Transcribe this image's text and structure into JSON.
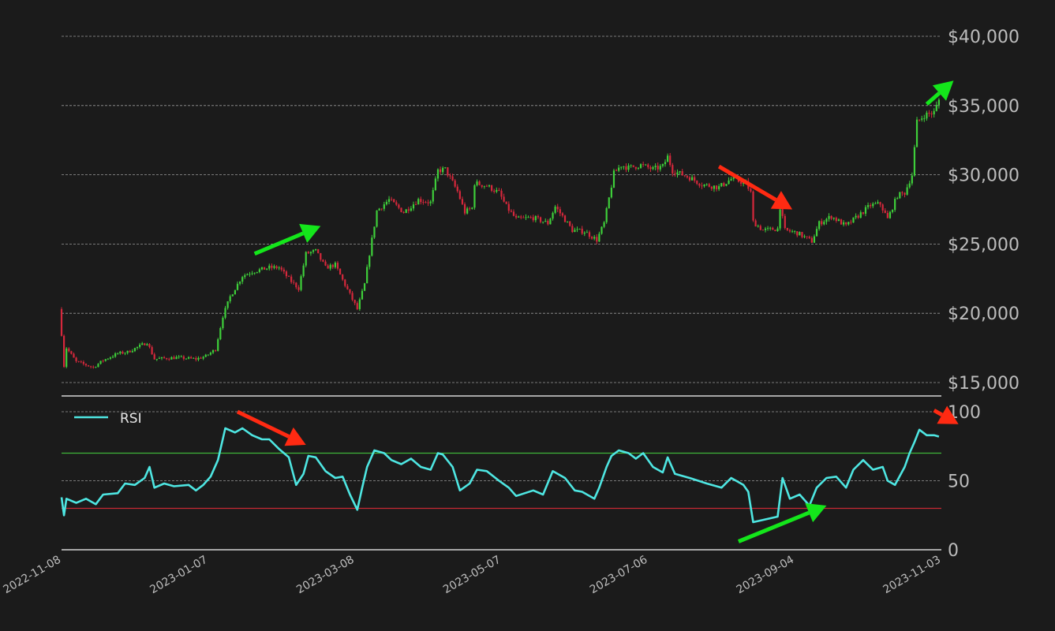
{
  "colors": {
    "background": "#1b1b1b",
    "up_candle": "#3ecf3a",
    "down_candle": "#d6283c",
    "rsi_line": "#4ee6e2",
    "overbought_line": "#3fb63a",
    "oversold_line": "#c82a33",
    "grid": "#9a9a9a",
    "axis_text": "#bdbdbd",
    "arrow_green": "#14e61b",
    "arrow_red": "#ff2a12"
  },
  "chart_data": [
    {
      "type": "candlestick",
      "title": "",
      "xlabel": "",
      "ylabel": "",
      "ylim": [
        14000,
        40500
      ],
      "y_ticks": [
        15000,
        20000,
        25000,
        30000,
        35000,
        40000
      ],
      "y_tick_labels": [
        "$15,000",
        "$20,000",
        "$25,000",
        "$30,000",
        "$35,000",
        "$40,000"
      ],
      "x_range": [
        "2022-11-08",
        "2023-11-03"
      ],
      "x_tick_labels": [
        "2022-11-08",
        "2023-01-07",
        "2023-03-08",
        "2023-05-07",
        "2023-07-06",
        "2023-09-04",
        "2023-11-03"
      ],
      "grid": true,
      "close_anchors": [
        [
          "2022-11-08",
          18500
        ],
        [
          "2022-11-09",
          16200
        ],
        [
          "2022-11-10",
          17500
        ],
        [
          "2022-11-14",
          16500
        ],
        [
          "2022-11-21",
          16100
        ],
        [
          "2022-11-25",
          16600
        ],
        [
          "2022-12-01",
          17100
        ],
        [
          "2022-12-05",
          17200
        ],
        [
          "2022-12-13",
          17900
        ],
        [
          "2022-12-16",
          16700
        ],
        [
          "2022-12-25",
          16800
        ],
        [
          "2023-01-02",
          16700
        ],
        [
          "2023-01-06",
          16900
        ],
        [
          "2023-01-10",
          17400
        ],
        [
          "2023-01-13",
          19800
        ],
        [
          "2023-01-16",
          21200
        ],
        [
          "2023-01-21",
          22700
        ],
        [
          "2023-01-25",
          23000
        ],
        [
          "2023-02-01",
          23300
        ],
        [
          "2023-02-05",
          23300
        ],
        [
          "2023-02-10",
          22300
        ],
        [
          "2023-02-13",
          21800
        ],
        [
          "2023-02-16",
          24300
        ],
        [
          "2023-02-20",
          24500
        ],
        [
          "2023-02-24",
          23300
        ],
        [
          "2023-02-28",
          23500
        ],
        [
          "2023-03-03",
          22400
        ],
        [
          "2023-03-09",
          20300
        ],
        [
          "2023-03-12",
          22100
        ],
        [
          "2023-03-14",
          24300
        ],
        [
          "2023-03-17",
          27400
        ],
        [
          "2023-03-22",
          28200
        ],
        [
          "2023-03-28",
          27300
        ],
        [
          "2023-04-03",
          28200
        ],
        [
          "2023-04-08",
          28000
        ],
        [
          "2023-04-11",
          30300
        ],
        [
          "2023-04-14",
          30400
        ],
        [
          "2023-04-19",
          28800
        ],
        [
          "2023-04-22",
          27300
        ],
        [
          "2023-04-25",
          27600
        ],
        [
          "2023-04-26",
          29400
        ],
        [
          "2023-05-01",
          29200
        ],
        [
          "2023-05-06",
          28700
        ],
        [
          "2023-05-09",
          27700
        ],
        [
          "2023-05-13",
          26800
        ],
        [
          "2023-05-20",
          26900
        ],
        [
          "2023-05-26",
          26500
        ],
        [
          "2023-05-29",
          27700
        ],
        [
          "2023-06-01",
          27000
        ],
        [
          "2023-06-05",
          26000
        ],
        [
          "2023-06-10",
          25900
        ],
        [
          "2023-06-15",
          25300
        ],
        [
          "2023-06-18",
          26500
        ],
        [
          "2023-06-20",
          28300
        ],
        [
          "2023-06-22",
          30100
        ],
        [
          "2023-06-25",
          30700
        ],
        [
          "2023-06-28",
          30500
        ],
        [
          "2023-07-03",
          30700
        ],
        [
          "2023-07-08",
          30400
        ],
        [
          "2023-07-12",
          30600
        ],
        [
          "2023-07-14",
          31300
        ],
        [
          "2023-07-16",
          30300
        ],
        [
          "2023-07-23",
          29800
        ],
        [
          "2023-07-28",
          29300
        ],
        [
          "2023-08-04",
          29100
        ],
        [
          "2023-08-09",
          29700
        ],
        [
          "2023-08-15",
          29400
        ],
        [
          "2023-08-17",
          28700
        ],
        [
          "2023-08-18",
          26600
        ],
        [
          "2023-08-22",
          26000
        ],
        [
          "2023-08-28",
          26100
        ],
        [
          "2023-08-29",
          27700
        ],
        [
          "2023-08-31",
          26000
        ],
        [
          "2023-09-05",
          25800
        ],
        [
          "2023-09-11",
          25200
        ],
        [
          "2023-09-14",
          26500
        ],
        [
          "2023-09-19",
          27000
        ],
        [
          "2023-09-25",
          26300
        ],
        [
          "2023-10-01",
          27200
        ],
        [
          "2023-10-05",
          27800
        ],
        [
          "2023-10-09",
          27900
        ],
        [
          "2023-10-12",
          26800
        ],
        [
          "2023-10-16",
          28500
        ],
        [
          "2023-10-19",
          28700
        ],
        [
          "2023-10-22",
          30000
        ],
        [
          "2023-10-24",
          33800
        ],
        [
          "2023-10-27",
          34300
        ],
        [
          "2023-10-31",
          34500
        ],
        [
          "2023-11-02",
          35400
        ]
      ]
    },
    {
      "type": "line",
      "title": "",
      "xlabel": "",
      "ylabel": "",
      "ylim": [
        0,
        100
      ],
      "y_ticks": [
        0,
        50,
        100
      ],
      "y_tick_labels": [
        "0",
        "50",
        "100"
      ],
      "legend": {
        "position": "top-left"
      },
      "overbought_level": 70,
      "oversold_level": 30,
      "series": [
        {
          "name": "RSI",
          "points": [
            [
              "2022-11-08",
              38
            ],
            [
              "2022-11-09",
              25
            ],
            [
              "2022-11-10",
              37
            ],
            [
              "2022-11-14",
              34
            ],
            [
              "2022-11-18",
              37
            ],
            [
              "2022-11-22",
              33
            ],
            [
              "2022-11-25",
              40
            ],
            [
              "2022-12-01",
              41
            ],
            [
              "2022-12-04",
              48
            ],
            [
              "2022-12-08",
              47
            ],
            [
              "2022-12-12",
              52
            ],
            [
              "2022-12-14",
              60
            ],
            [
              "2022-12-16",
              45
            ],
            [
              "2022-12-20",
              48
            ],
            [
              "2022-12-24",
              46
            ],
            [
              "2022-12-30",
              47
            ],
            [
              "2023-01-02",
              43
            ],
            [
              "2023-01-05",
              47
            ],
            [
              "2023-01-08",
              53
            ],
            [
              "2023-01-11",
              65
            ],
            [
              "2023-01-14",
              88
            ],
            [
              "2023-01-18",
              85
            ],
            [
              "2023-01-21",
              88
            ],
            [
              "2023-01-25",
              83
            ],
            [
              "2023-01-29",
              80
            ],
            [
              "2023-02-01",
              80
            ],
            [
              "2023-02-05",
              73
            ],
            [
              "2023-02-09",
              67
            ],
            [
              "2023-02-12",
              47
            ],
            [
              "2023-02-15",
              55
            ],
            [
              "2023-02-17",
              68
            ],
            [
              "2023-02-20",
              67
            ],
            [
              "2023-02-24",
              57
            ],
            [
              "2023-02-28",
              52
            ],
            [
              "2023-03-03",
              53
            ],
            [
              "2023-03-06",
              40
            ],
            [
              "2023-03-09",
              29
            ],
            [
              "2023-03-11",
              45
            ],
            [
              "2023-03-13",
              60
            ],
            [
              "2023-03-16",
              72
            ],
            [
              "2023-03-20",
              70
            ],
            [
              "2023-03-23",
              65
            ],
            [
              "2023-03-27",
              62
            ],
            [
              "2023-03-31",
              66
            ],
            [
              "2023-04-04",
              60
            ],
            [
              "2023-04-08",
              58
            ],
            [
              "2023-04-11",
              70
            ],
            [
              "2023-04-13",
              69
            ],
            [
              "2023-04-17",
              60
            ],
            [
              "2023-04-20",
              43
            ],
            [
              "2023-04-24",
              48
            ],
            [
              "2023-04-27",
              58
            ],
            [
              "2023-05-01",
              57
            ],
            [
              "2023-05-06",
              50
            ],
            [
              "2023-05-10",
              45
            ],
            [
              "2023-05-13",
              39
            ],
            [
              "2023-05-20",
              43
            ],
            [
              "2023-05-24",
              40
            ],
            [
              "2023-05-28",
              57
            ],
            [
              "2023-06-02",
              52
            ],
            [
              "2023-06-06",
              43
            ],
            [
              "2023-06-09",
              42
            ],
            [
              "2023-06-14",
              37
            ],
            [
              "2023-06-16",
              45
            ],
            [
              "2023-06-19",
              60
            ],
            [
              "2023-06-21",
              68
            ],
            [
              "2023-06-24",
              72
            ],
            [
              "2023-06-28",
              70
            ],
            [
              "2023-07-01",
              66
            ],
            [
              "2023-07-04",
              70
            ],
            [
              "2023-07-08",
              60
            ],
            [
              "2023-07-12",
              56
            ],
            [
              "2023-07-14",
              67
            ],
            [
              "2023-07-17",
              55
            ],
            [
              "2023-07-23",
              52
            ],
            [
              "2023-07-30",
              48
            ],
            [
              "2023-08-05",
              45
            ],
            [
              "2023-08-09",
              52
            ],
            [
              "2023-08-14",
              47
            ],
            [
              "2023-08-16",
              42
            ],
            [
              "2023-08-18",
              20
            ],
            [
              "2023-08-23",
              22
            ],
            [
              "2023-08-28",
              24
            ],
            [
              "2023-08-30",
              52
            ],
            [
              "2023-09-02",
              37
            ],
            [
              "2023-09-06",
              40
            ],
            [
              "2023-09-10",
              32
            ],
            [
              "2023-09-13",
              45
            ],
            [
              "2023-09-17",
              52
            ],
            [
              "2023-09-21",
              53
            ],
            [
              "2023-09-25",
              45
            ],
            [
              "2023-09-28",
              58
            ],
            [
              "2023-10-02",
              65
            ],
            [
              "2023-10-06",
              58
            ],
            [
              "2023-10-10",
              60
            ],
            [
              "2023-10-12",
              50
            ],
            [
              "2023-10-15",
              47
            ],
            [
              "2023-10-19",
              60
            ],
            [
              "2023-10-21",
              70
            ],
            [
              "2023-10-23",
              78
            ],
            [
              "2023-10-25",
              87
            ],
            [
              "2023-10-28",
              83
            ],
            [
              "2023-10-31",
              83
            ],
            [
              "2023-11-02",
              82
            ]
          ]
        }
      ]
    }
  ],
  "annotations": [
    {
      "panel": "price",
      "color": "green",
      "from": [
        "2023-01-26",
        24300
      ],
      "to": [
        "2023-02-22",
        26300
      ]
    },
    {
      "panel": "price",
      "color": "red",
      "from": [
        "2023-08-04",
        30600
      ],
      "to": [
        "2023-09-03",
        27500
      ]
    },
    {
      "panel": "price",
      "color": "green",
      "from": [
        "2023-10-28",
        35100
      ],
      "to": [
        "2023-11-08",
        36800
      ]
    },
    {
      "panel": "rsi",
      "color": "red",
      "from": [
        "2023-01-19",
        100
      ],
      "to": [
        "2023-02-16",
        76
      ]
    },
    {
      "panel": "rsi",
      "color": "green",
      "from": [
        "2023-08-12",
        6
      ],
      "to": [
        "2023-09-17",
        32
      ]
    },
    {
      "panel": "rsi",
      "color": "red",
      "from": [
        "2023-10-31",
        101
      ],
      "to": [
        "2023-11-10",
        91
      ]
    }
  ]
}
